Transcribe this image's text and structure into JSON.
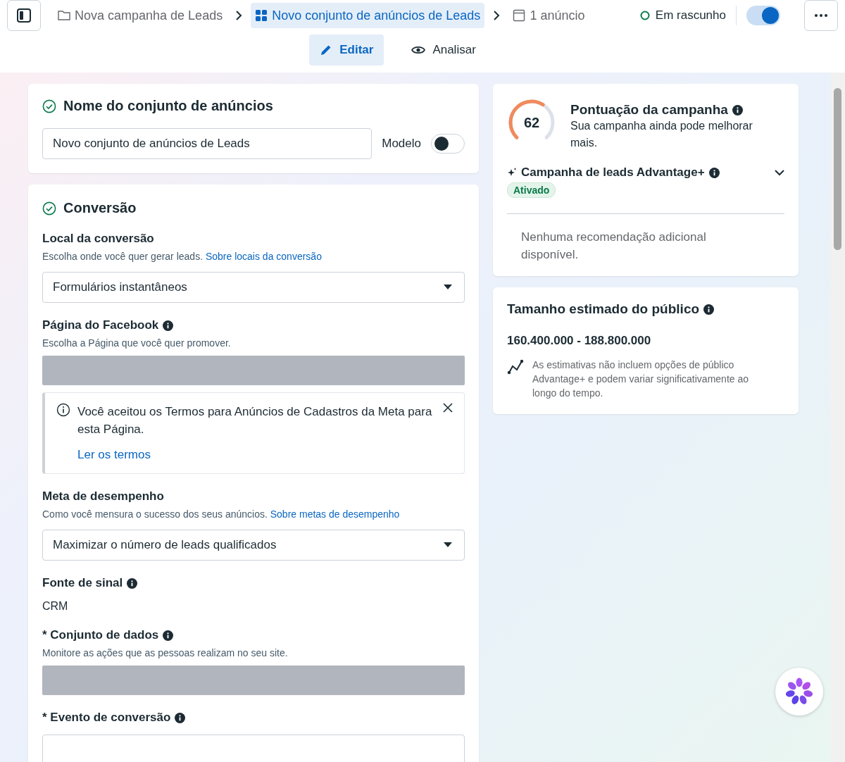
{
  "topbar": {
    "breadcrumbs": [
      {
        "kind": "campaign",
        "label": "Nova campanha de Leads",
        "selected": false
      },
      {
        "kind": "adset",
        "label": "Novo conjunto de anúncios de Leads",
        "selected": true
      },
      {
        "kind": "ad",
        "label": "1 anúncio",
        "selected": false
      }
    ],
    "status": "Em rascunho",
    "toggle_on": true,
    "modes": [
      {
        "kind": "edit",
        "label": "Editar",
        "selected": true
      },
      {
        "kind": "review",
        "label": "Analisar",
        "selected": false
      }
    ]
  },
  "name_card": {
    "title": "Nome do conjunto de anúncios",
    "value": "Novo conjunto de anúncios de Leads",
    "template_label": "Modelo",
    "template_on": false
  },
  "conversion_card": {
    "title": "Conversão",
    "sections": [
      {
        "kind": "select",
        "label": "Local da conversão",
        "info": false,
        "hint": "Escolha onde você quer gerar leads.",
        "link": "Sobre locais da conversão",
        "value": "Formulários instantâneos"
      },
      {
        "kind": "redacted",
        "label": "Página do Facebook",
        "info": true,
        "hint": "Escolha a Página que você quer promover."
      },
      {
        "kind": "notice",
        "text": "Você aceitou os Termos para Anúncios de Cadastros da Meta para esta Página.",
        "link": "Ler os termos"
      },
      {
        "kind": "select",
        "label": "Meta de desempenho",
        "info": false,
        "hint": "Como você mensura o sucesso dos seus anúncios.",
        "link": "Sobre metas de desempenho",
        "value": "Maximizar o número de leads qualificados"
      },
      {
        "kind": "text",
        "label": "Fonte de sinal",
        "info": true,
        "value": "CRM"
      },
      {
        "kind": "redacted",
        "label": "* Conjunto de dados",
        "info": true,
        "hint": "Monitore as ações que as pessoas realizam no seu site."
      },
      {
        "kind": "field",
        "label": "* Evento de conversão",
        "info": true
      }
    ]
  },
  "score_card": {
    "score": "62",
    "title": "Pontuação da campanha",
    "subtitle": "Sua campanha ainda pode melhorar mais.",
    "advantage": {
      "title": "Campanha de leads Advantage+",
      "badge": "Ativado",
      "expanded": false
    },
    "note": "Nenhuma recomendação adicional disponível."
  },
  "audience_card": {
    "title": "Tamanho estimado do público",
    "range": "160.400.000 - 188.800.000",
    "note": "As estimativas não incluem opções de público Advantage+ e podem variar significativamente ao longo do tempo."
  }
}
